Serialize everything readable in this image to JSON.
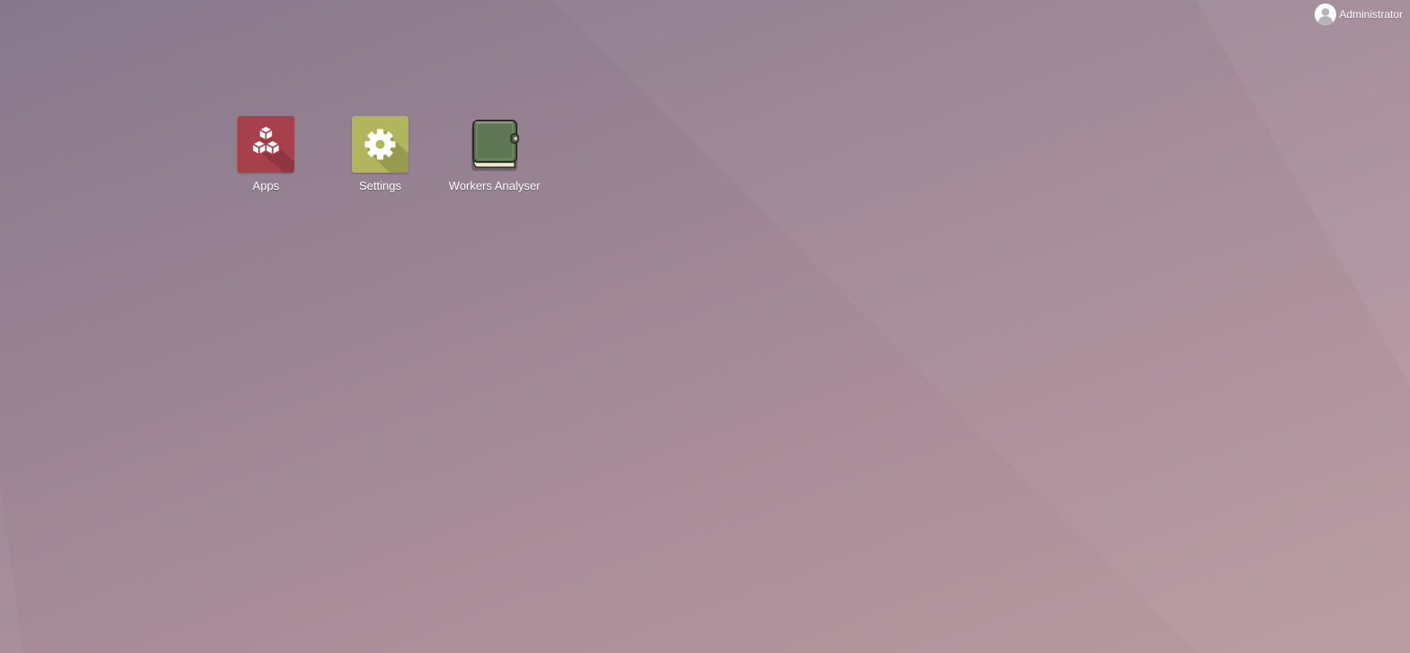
{
  "header": {
    "user_name": "Administrator",
    "avatar_icon": "user-avatar-icon"
  },
  "apps": [
    {
      "label": "Apps",
      "icon": "cubes-icon",
      "color": "#a8404c"
    },
    {
      "label": "Settings",
      "icon": "gear-icon",
      "color": "#b3b55c"
    },
    {
      "label": "Workers Analyser",
      "icon": "green-book-icon",
      "color": "#5f7654"
    }
  ],
  "theme": {
    "background_start": "#87788c",
    "background_end": "#b89aa1"
  }
}
